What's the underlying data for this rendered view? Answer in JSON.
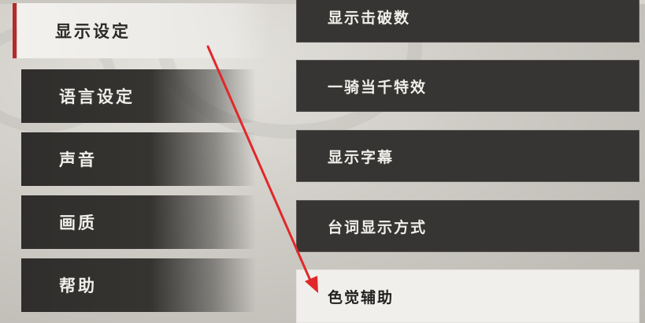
{
  "left_menu": {
    "items": [
      {
        "label": "显示设定",
        "selected": true
      },
      {
        "label": "语言设定",
        "selected": false
      },
      {
        "label": "声音",
        "selected": false
      },
      {
        "label": "画质",
        "selected": false
      },
      {
        "label": "帮助",
        "selected": false
      }
    ]
  },
  "options": {
    "items": [
      {
        "label": "显示击破数"
      },
      {
        "label": "一骑当千特效"
      },
      {
        "label": "显示字幕"
      },
      {
        "label": "台词显示方式"
      },
      {
        "label": "色觉辅助",
        "highlighted": true
      }
    ]
  },
  "colors": {
    "accent_selection": "#b52a2a",
    "annotation_arrow": "#e0282a",
    "button_dark": "#363533",
    "button_highlight": "#f0efec"
  }
}
